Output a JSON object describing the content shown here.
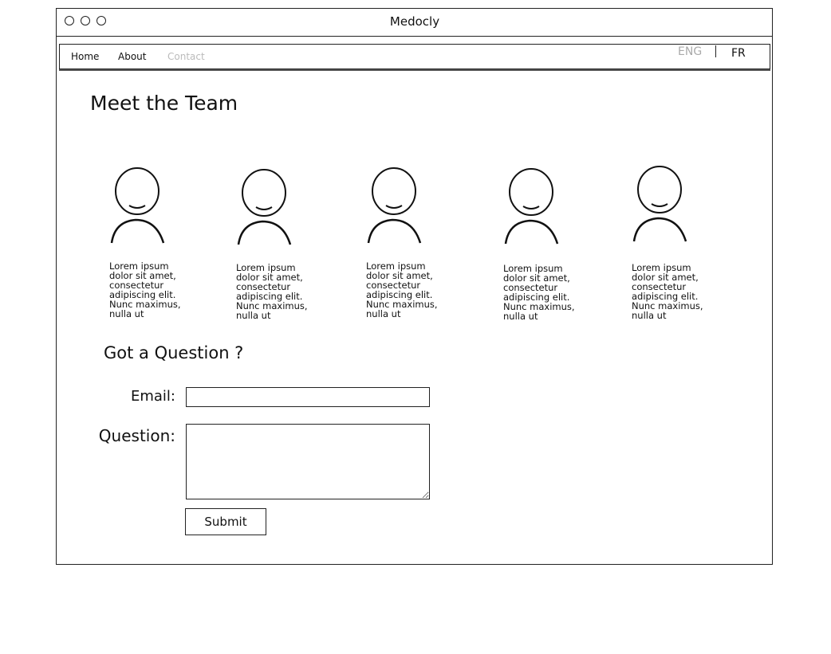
{
  "window": {
    "title": "Medocly"
  },
  "nav": {
    "links": [
      "Home",
      "About",
      "Contact"
    ],
    "languages": [
      "ENG",
      "FR"
    ]
  },
  "team": {
    "heading": "Meet the Team",
    "members": [
      {
        "bio": "Lorem ipsum dolor sit amet, consectetur adipiscing elit. Nunc maximus, nulla ut"
      },
      {
        "bio": "Lorem ipsum dolor sit amet, consectetur adipiscing elit. Nunc maximus, nulla ut"
      },
      {
        "bio": "Lorem ipsum dolor sit amet, consectetur adipiscing elit. Nunc maximus, nulla ut"
      },
      {
        "bio": "Lorem ipsum dolor sit amet, consectetur adipiscing elit. Nunc maximus, nulla ut"
      },
      {
        "bio": "Lorem ipsum dolor sit amet, consectetur adipiscing elit. Nunc maximus, nulla ut"
      }
    ]
  },
  "form": {
    "heading": "Got a Question ?",
    "email_label": "Email:",
    "email_value": "",
    "question_label": "Question:",
    "question_value": "",
    "submit_label": "Submit"
  }
}
